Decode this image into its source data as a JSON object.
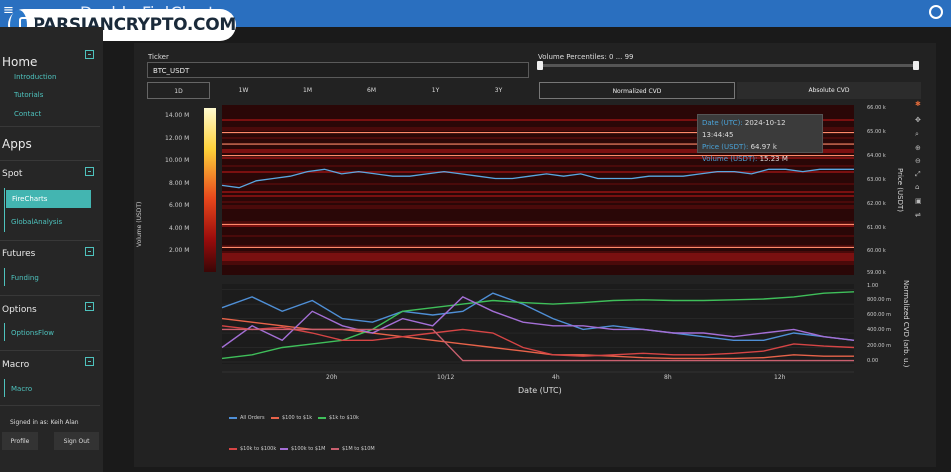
{
  "header": {
    "title": "Dashboard",
    "subtitle": "FireCharts",
    "logo_text": "PARSIANCRYPTO.COM"
  },
  "sidebar": {
    "home_title": "Home",
    "home_links": [
      "Introduction",
      "Tutorials",
      "Contact"
    ],
    "apps_title": "Apps",
    "sections": [
      {
        "title": "Spot",
        "items": [
          "FireCharts",
          "GlobalAnalysis"
        ],
        "active": "FireCharts"
      },
      {
        "title": "Futures",
        "items": [
          "Funding"
        ]
      },
      {
        "title": "Options",
        "items": [
          "OptionsFlow"
        ]
      },
      {
        "title": "Macro",
        "items": [
          "Macro"
        ]
      }
    ],
    "signed_in": "Signed in as: Keih Alan",
    "profile_label": "Profile",
    "signout_label": "Sign Out"
  },
  "controls": {
    "ticker_label": "Ticker",
    "ticker_value": "BTC_USDT",
    "percentile_label": "Volume Percentiles: 0 ... 99",
    "percentile_range": [
      0,
      99
    ],
    "timeframes": [
      "1D",
      "1W",
      "1M",
      "6M",
      "1Y",
      "3Y"
    ],
    "selected_timeframe": "1D",
    "modes": [
      "Normalized CVD",
      "Absolute CVD"
    ],
    "selected_mode": "Normalized CVD"
  },
  "tooltip": {
    "date_key": "Date (UTC):",
    "date_val": "2024-10-12 13:44:45",
    "price_key": "Price (USDT):",
    "price_val": "64.97 k",
    "volume_key": "Volume (USDT):",
    "volume_val": "15.23 M"
  },
  "colors": {
    "accent": "#43b5b1",
    "topbar": "#2a6fbf",
    "price_line": "#5aa7e0"
  },
  "chart_data": [
    {
      "type": "heatmap",
      "title": "",
      "xlabel": "Date (UTC)",
      "ylabel": "Price (USDT)",
      "colorbar_label": "Volume (USDT)",
      "colorbar_ticks": [
        "14.00 M",
        "12.00 M",
        "10.00 M",
        "8.00 M",
        "6.00 M",
        "4.00 M",
        "2.00 M"
      ],
      "y_ticks": [
        "66.00 k",
        "65.00 k",
        "64.00 k",
        "63.00 k",
        "62.00 k",
        "61.00 k",
        "60.00 k",
        "59.00 k"
      ],
      "ylim": [
        58.8,
        66.2
      ],
      "price_series": {
        "name": "Price",
        "x_hours": [
          0,
          1,
          2,
          3,
          4,
          5,
          6,
          7,
          8,
          9,
          10,
          11,
          12,
          13,
          14,
          15,
          16,
          17,
          18,
          19,
          20,
          21,
          22,
          23,
          24,
          25,
          26,
          27,
          28,
          29,
          30,
          31,
          32,
          33,
          34,
          35,
          36,
          37
        ],
        "y": [
          62.7,
          62.6,
          62.9,
          63.0,
          63.1,
          63.3,
          63.4,
          63.2,
          63.3,
          63.2,
          63.1,
          63.1,
          63.2,
          63.3,
          63.2,
          63.1,
          63.0,
          63.0,
          63.1,
          63.2,
          63.1,
          63.2,
          63.0,
          63.0,
          63.0,
          63.1,
          63.1,
          63.1,
          63.2,
          63.3,
          63.3,
          63.2,
          63.4,
          63.4,
          63.3,
          63.4,
          63.4,
          63.4
        ]
      },
      "bright_levels": [
        65.0,
        64.5,
        64.0,
        61.0,
        60.0
      ]
    },
    {
      "type": "line",
      "xlabel": "Date (UTC)",
      "ylabel": "Normalized CVD (arb. u.)",
      "x_ticks": [
        "20h",
        "10/12",
        "4h",
        "8h",
        "12h"
      ],
      "y_ticks": [
        "0.00",
        "200.00 m",
        "400.00 m",
        "600.00 m",
        "800.00 m",
        "1.00"
      ],
      "ylim": [
        0,
        1.05
      ],
      "series": [
        {
          "name": "All Orders",
          "color": "#4f8fd6",
          "values": [
            0.75,
            0.9,
            0.7,
            0.85,
            0.6,
            0.55,
            0.7,
            0.65,
            0.7,
            0.95,
            0.8,
            0.6,
            0.45,
            0.5,
            0.45,
            0.4,
            0.35,
            0.3,
            0.3,
            0.4,
            0.35,
            0.3
          ]
        },
        {
          "name": "$100 to $1k",
          "color": "#e8634a",
          "values": [
            0.6,
            0.55,
            0.5,
            0.45,
            0.45,
            0.4,
            0.35,
            0.3,
            0.25,
            0.2,
            0.15,
            0.1,
            0.1,
            0.08,
            0.06,
            0.05,
            0.05,
            0.05,
            0.06,
            0.1,
            0.08,
            0.08
          ]
        },
        {
          "name": "$1k to $10k",
          "color": "#3fbf5a",
          "values": [
            0.05,
            0.1,
            0.2,
            0.25,
            0.3,
            0.45,
            0.7,
            0.75,
            0.8,
            0.85,
            0.82,
            0.8,
            0.82,
            0.85,
            0.86,
            0.85,
            0.85,
            0.86,
            0.87,
            0.9,
            0.95,
            0.97
          ]
        },
        {
          "name": "$10k to $100k",
          "color": "#d64545",
          "values": [
            0.5,
            0.45,
            0.48,
            0.4,
            0.3,
            0.3,
            0.35,
            0.4,
            0.45,
            0.4,
            0.2,
            0.1,
            0.08,
            0.1,
            0.12,
            0.1,
            0.1,
            0.12,
            0.15,
            0.25,
            0.22,
            0.2
          ]
        },
        {
          "name": "$100k to $1M",
          "color": "#a46fd6",
          "values": [
            0.2,
            0.5,
            0.3,
            0.7,
            0.5,
            0.4,
            0.6,
            0.5,
            0.9,
            0.7,
            0.55,
            0.5,
            0.5,
            0.45,
            0.45,
            0.4,
            0.4,
            0.35,
            0.4,
            0.45,
            0.35,
            0.3
          ]
        },
        {
          "name": "$1M to $10M",
          "color": "#c9606f",
          "values": [
            0.45,
            0.45,
            0.45,
            0.45,
            0.45,
            0.45,
            0.45,
            0.45,
            0.02,
            0.02,
            0.02,
            0.02,
            0.02,
            0.02,
            0.02,
            0.02,
            0.02,
            0.02,
            0.02,
            0.02,
            0.02,
            0.02
          ]
        }
      ]
    }
  ]
}
